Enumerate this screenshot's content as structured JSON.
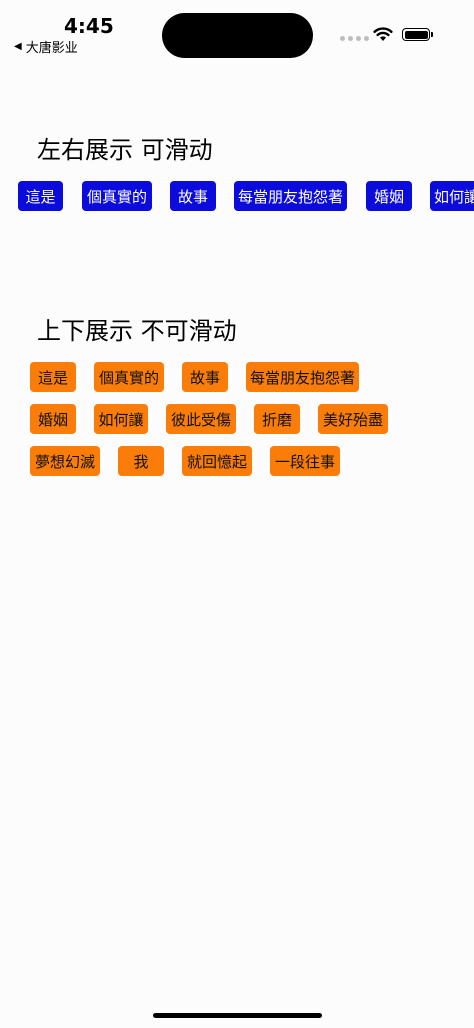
{
  "status_bar": {
    "time": "4:45",
    "back_app_label": "大唐影业"
  },
  "horizontal_section": {
    "title": "左右展示 可滑动",
    "tags": [
      "這是",
      "個真實的",
      "故事",
      "每當朋友抱怨著",
      "婚姻",
      "如何讓"
    ]
  },
  "vertical_section": {
    "title": "上下展示 不可滑动",
    "tags": [
      "這是",
      "個真實的",
      "故事",
      "每當朋友抱怨著",
      "婚姻",
      "如何讓",
      "彼此受傷",
      "折磨",
      "美好殆盡",
      "夢想幻滅",
      "我",
      "就回憶起",
      "一段往事"
    ]
  },
  "colors": {
    "horizontal_tag_bg": "#0b0bdc",
    "vertical_tag_bg": "#f97d08"
  }
}
